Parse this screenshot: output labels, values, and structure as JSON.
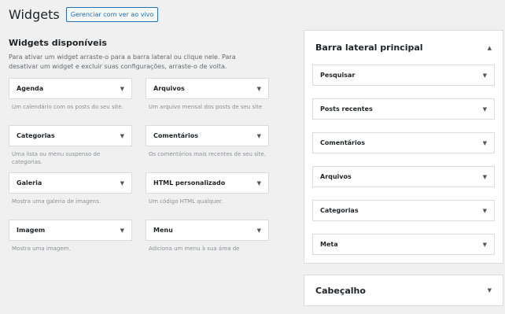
{
  "header": {
    "title": "Widgets",
    "live_button": "Gerenciar com ver ao vivo"
  },
  "available": {
    "title": "Widgets disponíveis",
    "description": "Para ativar um widget arraste-o para a barra lateral ou clique nele. Para desativar um widget e excluir suas configurações, arraste-o de volta.",
    "widgets": [
      {
        "name": "Agenda",
        "desc": "Um calendário com os posts do seu site."
      },
      {
        "name": "Arquivos",
        "desc": "Um arquivo mensal dos posts de seu site"
      },
      {
        "name": "Categorias",
        "desc": "Uma lista ou menu suspenso de categorias."
      },
      {
        "name": "Comentários",
        "desc": "Os comentários mais recentes de seu site."
      },
      {
        "name": "Galeria",
        "desc": "Mostra uma galeria de imagens."
      },
      {
        "name": "HTML personalizado",
        "desc": "Um código HTML qualquer."
      },
      {
        "name": "Imagem",
        "desc": "Mostra uma imagem."
      },
      {
        "name": "Menu",
        "desc": "Adiciona um menu à sua área de"
      }
    ]
  },
  "sidebar": {
    "title": "Barra lateral principal",
    "items": [
      "Pesquisar",
      "Posts recentes",
      "Comentários",
      "Arquivos",
      "Categorias",
      "Meta"
    ]
  },
  "header_area": {
    "title": "Cabeçalho"
  },
  "icons": {
    "dropdown": "▼",
    "collapse": "▲"
  }
}
